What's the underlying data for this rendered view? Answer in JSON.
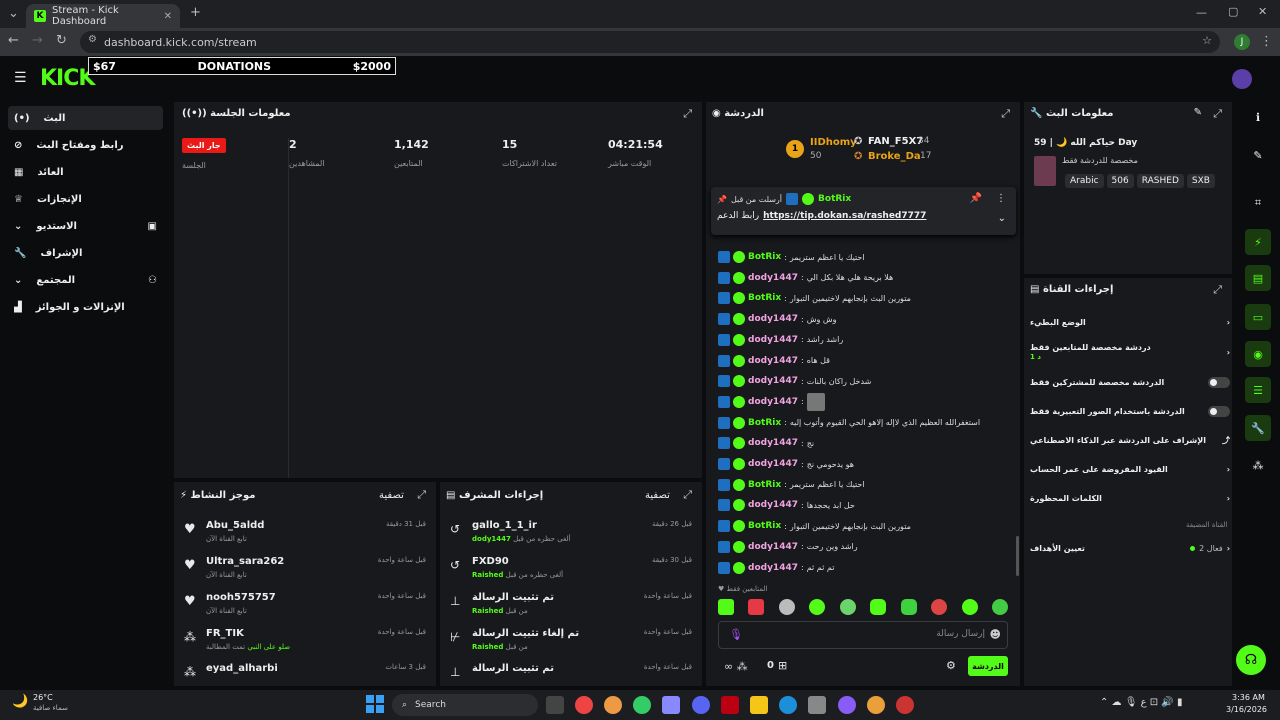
{
  "browser": {
    "tab_title": "Stream - Kick Dashboard",
    "url": "dashboard.kick.com/stream",
    "profile_initial": "J"
  },
  "header": {
    "logo": "KICK",
    "donation_left": "$67",
    "donation_title": "DONATIONS",
    "donation_right": "$2000",
    "tiny_label": "ᕈ"
  },
  "sidebar": {
    "items": [
      {
        "label": "البث"
      },
      {
        "label": "رابط ومفتاح البث"
      },
      {
        "label": "العائد"
      },
      {
        "label": "الإنجازات"
      },
      {
        "label": "الاستديو"
      },
      {
        "label": "الإشراف"
      },
      {
        "label": "المجتمع"
      },
      {
        "label": "الإنزالات و الجوائز"
      }
    ]
  },
  "session": {
    "title": "معلومات الجلسة",
    "live_badge": "جار البث",
    "stats": [
      {
        "label": "الجلسة",
        "value": ""
      },
      {
        "label": "المشاهدين",
        "value": "2"
      },
      {
        "label": "المتابعين",
        "value": "1,142"
      },
      {
        "label": "تعداد الاشتراكات",
        "value": "15"
      },
      {
        "label": "الوقت مباشر",
        "value": "04:21:54"
      }
    ]
  },
  "activity": {
    "title": "موجز النشاط",
    "filter": "تصفية",
    "items": [
      {
        "name": "Abu_5aldd",
        "sub": "تابع القناة الآن",
        "time": "قبل 31 دقيقة"
      },
      {
        "name": "Ultra_sara262",
        "sub": "تابع القناة الآن",
        "time": "قبل ساعة واحدة"
      },
      {
        "name": "nooh575757",
        "sub": "تابع القناة الآن",
        "time": "قبل ساعة واحدة"
      },
      {
        "name": "FR_TIK",
        "sub": "تمت المطالبة",
        "sub2": "صلو على النبي",
        "time": "قبل ساعة واحدة"
      },
      {
        "name": "eyad_alharbi",
        "sub": "",
        "time": "قبل 3 ساعات"
      }
    ]
  },
  "modactions": {
    "title": "إجراءات المشرف",
    "filter": "تصفية",
    "items": [
      {
        "name": "gallo_1_1_ir",
        "sub": "ألغى حظره من قبل",
        "by": "dody1447",
        "time": "قبل 26 دقيقة"
      },
      {
        "name": "FXD90",
        "sub": "ألغى حظره من قبل",
        "by": "Raished",
        "time": "قبل 30 دقيقة"
      },
      {
        "name": "تم تثبيت الرسالة",
        "sub": "من قبل",
        "by": "Raished",
        "time": "قبل ساعة واحدة"
      },
      {
        "name": "تم إلغاء تثبيت الرسالة",
        "sub": "من قبل",
        "by": "Raished",
        "time": "قبل ساعة واحدة"
      },
      {
        "name": "تم تثبيت الرسالة",
        "sub": "",
        "by": "",
        "time": "قبل ساعة واحدة"
      }
    ]
  },
  "chat": {
    "title": "الدردشة",
    "leaders": [
      {
        "name": "IIDhomy",
        "count": "50",
        "rank": "1"
      },
      {
        "name": "FAN_F5X7",
        "count": "34"
      },
      {
        "name": "Broke_Da",
        "count": "17"
      }
    ],
    "pinned_by": "أرسلت من قبل",
    "pinned_user": "BotRix",
    "pinned_label": "رابط الدعم",
    "pinned_link": "https://tip.dokan.sa/rashed7777",
    "messages": [
      {
        "user": "BotRix",
        "text": "احتيك يا اعظم ستريمر",
        "color": "#53fc18"
      },
      {
        "user": "dody1447",
        "text": "هلا بريحة هلي هلا بكل الي",
        "color": "#f0a3e0"
      },
      {
        "user": "BotRix",
        "text": "متورين البث بإنجابهم لاختيمين التبوار",
        "color": "#53fc18"
      },
      {
        "user": "dody1447",
        "text": "وش وش",
        "color": "#f0a3e0"
      },
      {
        "user": "dody1447",
        "text": "راشد راشد",
        "color": "#f0a3e0"
      },
      {
        "user": "dody1447",
        "text": "قل هاه",
        "color": "#f0a3e0"
      },
      {
        "user": "dody1447",
        "text": "شدخل راكان بالنات",
        "color": "#f0a3e0"
      },
      {
        "user": "dody1447",
        "text": "",
        "color": "#f0a3e0"
      },
      {
        "user": "BotRix",
        "text": "استغفرالله العظيم الذي لاإله إلاهو الحي القيوم وأتوب إليه",
        "color": "#53fc18"
      },
      {
        "user": "dody1447",
        "text": "نج",
        "color": "#f0a3e0"
      },
      {
        "user": "dody1447",
        "text": "هو يدحومي نج",
        "color": "#f0a3e0"
      },
      {
        "user": "BotRix",
        "text": "احتيك يا اعظم ستريمر",
        "color": "#53fc18"
      },
      {
        "user": "dody1447",
        "text": "حل ابد يحجدها",
        "color": "#f0a3e0"
      },
      {
        "user": "BotRix",
        "text": "متورين البث بإنجابهم لاختيمين التبوار",
        "color": "#53fc18"
      },
      {
        "user": "dody1447",
        "text": "راشد وين رحت",
        "color": "#f0a3e0"
      },
      {
        "user": "dody1447",
        "text": "تم ثم ثم",
        "color": "#f0a3e0"
      }
    ],
    "followers_only": "المتابعين فقط",
    "input_placeholder": "إرسال رسالة",
    "count": "0",
    "send": "الدردشة"
  },
  "stream_info": {
    "title": "معلومات البث",
    "stream_title": "حياكم الله 🌙 | 59 Day",
    "category": "مخصصة للدردشة فقط",
    "tags": [
      "Arabic",
      "506",
      "RASHED",
      "SXB"
    ]
  },
  "channel_actions": {
    "title": "إجراءات القناة",
    "rows": [
      {
        "label": "الوضع البطيء",
        "kind": "chevron"
      },
      {
        "label": "دردشة مخصصة للمتابعين فقط",
        "sub": "1 د",
        "kind": "chevron"
      },
      {
        "label": "الدردشة مخصصة للمشتركين فقط",
        "kind": "toggle"
      },
      {
        "label": "الدردشة باستخدام الصور التعبيرية فقط",
        "kind": "toggle"
      },
      {
        "label": "الإشراف على الدردشة عبر الذكاء الاصطناعي",
        "kind": "external"
      },
      {
        "label": "القيود المفروضة على عمر الحساب",
        "kind": "chevron"
      },
      {
        "label": "الكلمات المحظورة",
        "kind": "chevron"
      }
    ],
    "section2": "القناة المضيفة",
    "goals_label": "تعيين الأهداف",
    "goals_status": "فعال 2"
  },
  "taskbar": {
    "weather_temp": "26°C",
    "weather_desc": "سماء صافية",
    "search": "Search",
    "time": "3:36 AM",
    "date": "3/16/2026"
  }
}
